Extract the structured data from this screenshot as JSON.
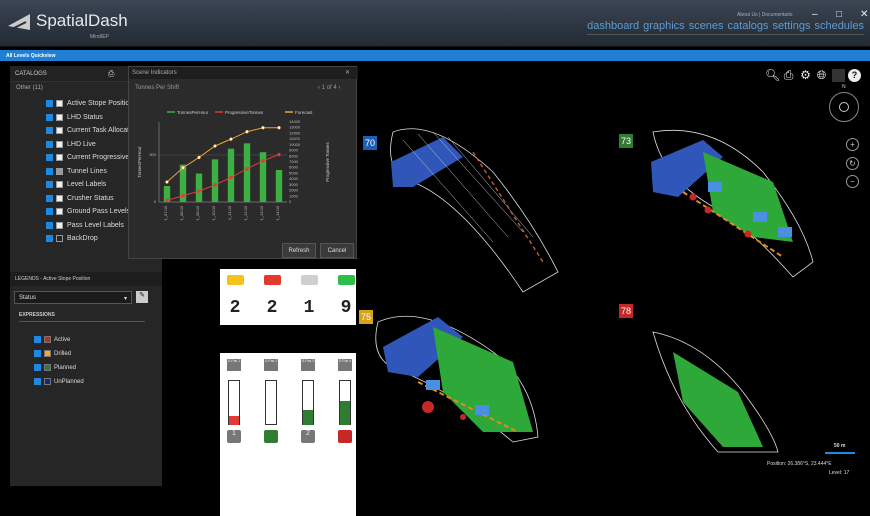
{
  "app": {
    "name": "SpatialDash",
    "sub": "MindIEP",
    "links": "About Us | Documentatio",
    "win": [
      "–",
      "□",
      "✕"
    ],
    "nav": [
      "dashboard",
      "graphics",
      "scenes",
      "catalogs",
      "settings",
      "schedules"
    ]
  },
  "breadcrumb": "All Levels Quickview",
  "catalogs": {
    "header": "CATALOGS",
    "group": "Other (11)",
    "items": [
      "Active Stope Position",
      "LHD Status",
      "Current Task Allocation",
      "LHD Live",
      "Current Progressive Task",
      "Tunnel Lines",
      "Level Labels",
      "Crusher Status",
      "Ground Pass Levels",
      "Pass Level Labels",
      "BackDrop"
    ]
  },
  "legends": {
    "header": "LEGENDS - Active Stope Position",
    "select": "Status",
    "expressions": "EXPRESSIONS",
    "items": [
      {
        "label": "Active",
        "color": "#c62828"
      },
      {
        "label": "Drilled",
        "color": "#f9a825"
      },
      {
        "label": "Planned",
        "color": "#2e7d32"
      },
      {
        "label": "UnPlanned",
        "color": "#1a237e"
      }
    ]
  },
  "dialog": {
    "title": "Scene Indicators",
    "close": "✕",
    "subtitle": "Tonnes Per Shift",
    "pager": "‹ 1 of 4 ›",
    "refresh": "Refresh",
    "cancel": "Cancel"
  },
  "chart_data": {
    "type": "bar",
    "categories": [
      "1_07.03",
      "1_08.03",
      "1_09.03",
      "1_10.03",
      "1_11.03",
      "1_12.03",
      "1_13.03",
      "1_14.03"
    ],
    "series": [
      {
        "name": "TonnesPerHour",
        "type": "bar",
        "values": [
          180,
          420,
          320,
          480,
          600,
          660,
          560,
          360
        ]
      },
      {
        "name": "ProgressiveTonnes",
        "type": "line",
        "values": [
          300,
          1100,
          1900,
          3000,
          4300,
          5800,
          7200,
          8300
        ]
      },
      {
        "name": "Forecast",
        "type": "line",
        "values": [
          3500,
          6000,
          7800,
          9800,
          11000,
          12300,
          13000,
          13000
        ]
      }
    ],
    "ylabel": "TonnesPerHour",
    "y2label": "Progressive Tonnes",
    "ylim": [
      0,
      900
    ],
    "y2lim": [
      0,
      14000
    ],
    "yticks": [
      "900",
      "0"
    ],
    "y2ticks": [
      "14000",
      "13000",
      "12000",
      "11000",
      "10000",
      "9000",
      "8000",
      "7000",
      "6000",
      "5000",
      "4000",
      "3000",
      "2000",
      "1000",
      "0"
    ],
    "legend": "top"
  },
  "lhd": {
    "counts": [
      "2",
      "2",
      "1",
      "9"
    ],
    "colors": [
      "#f4c21a",
      "#e23a2a",
      "#cfcfcf",
      "#2dbe4a"
    ]
  },
  "crusher": {
    "labels": [
      "S-Pas 1",
      "S-Pas 2",
      "S-Pas 3",
      "S-Pas 4"
    ],
    "bottom": [
      "1",
      "",
      "2",
      ""
    ],
    "levels": [
      0.2,
      0,
      0.35,
      0.55
    ],
    "fills": [
      "#e53935",
      "#e53935",
      "#2e7d32",
      "#2e7d32"
    ]
  },
  "levels": [
    {
      "num": "70",
      "color": "#1e5fb3"
    },
    {
      "num": "73",
      "color": "#2e7d32"
    },
    {
      "num": "75",
      "color": "#d5a21a"
    },
    {
      "num": "78",
      "color": "#c62828"
    }
  ],
  "status": {
    "scale": "50 m",
    "position": "Position: 26.386°S, 23.444°E",
    "level": "Level: 17"
  },
  "compass": "N"
}
